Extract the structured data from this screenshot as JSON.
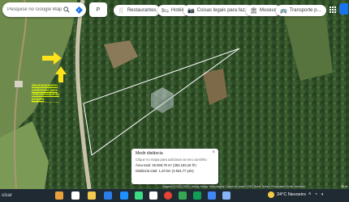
{
  "search": {
    "placeholder": "Pesquise no Google Maps"
  },
  "address_chip": "P",
  "chips": [
    {
      "icon": "🍴",
      "label": "Restaurantes"
    },
    {
      "icon": "🛏",
      "label": "Hotéis"
    },
    {
      "icon": "📷",
      "label": "Coisas legais para faz..."
    },
    {
      "icon": "🏛",
      "label": "Museus"
    },
    {
      "icon": "🚌",
      "label": "Transporte p..."
    }
  ],
  "callout_text": "desmatamento ambiental para reflorestamento projeto reflorestamento",
  "measure": {
    "title": "Medir distância",
    "hint": "Clique no mapa para adicionar ao seu caminho",
    "area": "Área total: 35.599,78 m² (383.183,26 ft²)",
    "distance": "Distância total: 1,20 km (3.934,77 pés)",
    "close": "×"
  },
  "attribution": "Imagens ©2023 CNES / Airbus, Maxar Technologies, Dados do mapa ©2023   Brasil   Termos   Privacidade   Enviar feedback",
  "scale": "50 m",
  "taskbar": {
    "search_text": "uisar",
    "weather": "24°C  Nevoeiro"
  },
  "colors": {
    "forest": "#2f4a2a",
    "field": "#6f8a4d",
    "callout_text": "#e4ff00",
    "arrow": "#ffe21a",
    "polygon": "#ffffff"
  }
}
